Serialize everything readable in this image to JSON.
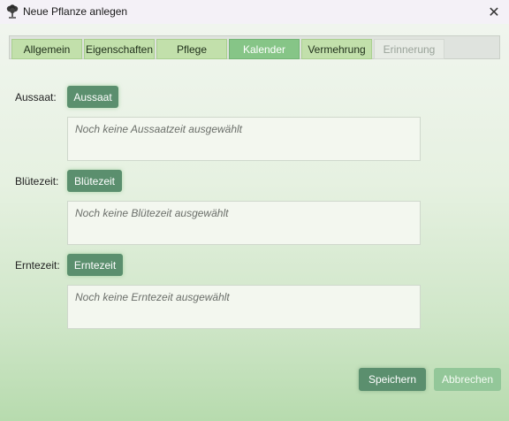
{
  "window": {
    "title": "Neue Pflanze anlegen",
    "close_symbol": "✕"
  },
  "tabs": [
    {
      "label": "Allgemein",
      "state": "normal"
    },
    {
      "label": "Eigenschaften",
      "state": "normal"
    },
    {
      "label": "Pflege",
      "state": "normal"
    },
    {
      "label": "Kalender",
      "state": "active"
    },
    {
      "label": "Vermehrung",
      "state": "normal"
    },
    {
      "label": "Erinnerung",
      "state": "disabled"
    }
  ],
  "calendar": {
    "sowing": {
      "label": "Aussaat:",
      "button": "Aussaat",
      "placeholder": "Noch keine Aussaatzeit ausgewählt"
    },
    "bloom": {
      "label": "Blütezeit:",
      "button": "Blütezeit",
      "placeholder": "Noch keine Blütezeit ausgewählt"
    },
    "harvest": {
      "label": "Erntezeit:",
      "button": "Erntezeit",
      "placeholder": "Noch keine Erntezeit ausgewählt"
    }
  },
  "footer": {
    "save_label": "Speichern",
    "cancel_label": "Abbrechen"
  },
  "colors": {
    "accent_dark": "#5b8f6e",
    "tab_active": "#86c587",
    "tab_normal": "#c2e0ab",
    "button_light": "#93c799"
  },
  "icons": {
    "app": "plant-tree-icon",
    "close": "close-icon"
  }
}
